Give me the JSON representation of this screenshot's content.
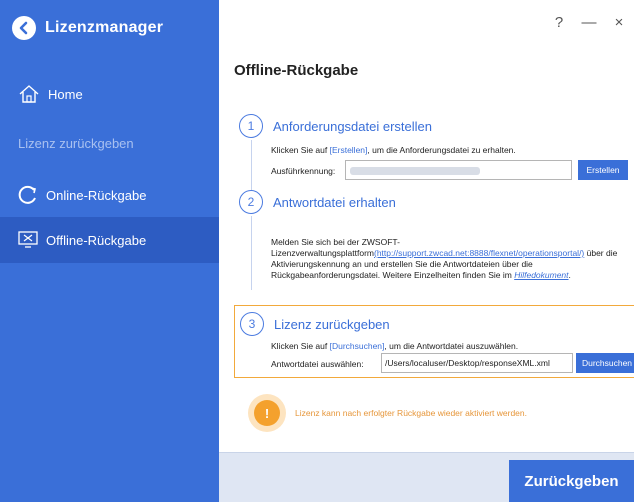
{
  "app": {
    "title": "Lizenzmanager"
  },
  "window": {
    "help": "?",
    "minimize": "—",
    "close": "×"
  },
  "sidebar": {
    "home": "Home",
    "section": "Lizenz zurückgeben",
    "online": "Online-Rückgabe",
    "offline": "Offline-Rückgabe"
  },
  "main": {
    "title": "Offline-Rückgabe",
    "step1": {
      "num": "1",
      "title": "Anforderungsdatei erstellen",
      "desc_pre": "Klicken Sie auf ",
      "desc_link": "[Erstellen]",
      "desc_post": ", um die Anforderungsdatei zu erhalten.",
      "field_label": "Ausführkennung:",
      "button": "Erstellen"
    },
    "step2": {
      "num": "2",
      "title": "Antwortdatei erhalten",
      "desc_pre": "Melden Sie sich bei der ZWSOFT-Lizenzverwaltungsplattform",
      "desc_link": "(http://support.zwcad.net:8888/flexnet/operationsportal/)",
      "desc_mid": " über die Aktivierungskennung an und erstellen Sie die Antwortdateien über die Rückgabeanforderungsdatei. Weitere Einzelheiten finden Sie im ",
      "desc_doc": "Hilfedokument",
      "desc_end": "."
    },
    "step3": {
      "num": "3",
      "title": "Lizenz zurückgeben",
      "desc_pre": "Klicken Sie auf ",
      "desc_link": "[Durchsuchen]",
      "desc_post": ", um die Antwortdatei auszuwählen.",
      "field_label": "Antwortdatei auswählen:",
      "field_value": "/Users/localuser/Desktop/responseXML.xml",
      "button": "Durchsuchen"
    },
    "tip": {
      "icon": "!",
      "text": "Lizenz kann nach erfolgter Rückgabe wieder aktiviert werden."
    },
    "submit": "Zurückgeben"
  },
  "colors": {
    "accent": "#3a6fd8",
    "sidebar": "#3a6fd8",
    "sidebar_active": "#2d5cc2",
    "warning": "#f4a12d",
    "highlight_border": "#f2a93b"
  }
}
